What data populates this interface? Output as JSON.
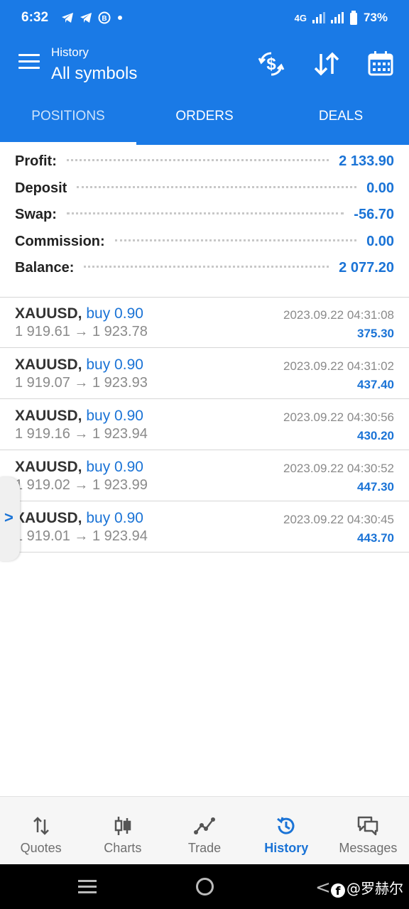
{
  "status_bar": {
    "time": "6:32",
    "network": "4G",
    "battery": "73%",
    "notif_icons": [
      "telegram-icon",
      "telegram-icon",
      "bitcoin-icon",
      "dot-icon"
    ]
  },
  "toolbar": {
    "subtitle": "History",
    "title": "All symbols",
    "icons": [
      "currency-exchange-icon",
      "sort-icon",
      "calendar-icon"
    ]
  },
  "tabs": [
    {
      "label": "POSITIONS",
      "active": true
    },
    {
      "label": "ORDERS",
      "active": false
    },
    {
      "label": "DEALS",
      "active": false
    }
  ],
  "summary": {
    "profit": {
      "label": "Profit:",
      "value": "2 133.90"
    },
    "deposit": {
      "label": "Deposit",
      "value": "0.00"
    },
    "swap": {
      "label": "Swap:",
      "value": "-56.70"
    },
    "commission": {
      "label": "Commission:",
      "value": "0.00"
    },
    "balance": {
      "label": "Balance:",
      "value": "2 077.20"
    }
  },
  "deals": [
    {
      "symbol": "XAUUSD,",
      "side": "buy 0.90",
      "open": "1 919.61",
      "arrow": "→",
      "close": "1 923.78",
      "time": "2023.09.22 04:31:08",
      "profit": "375.30"
    },
    {
      "symbol": "XAUUSD,",
      "side": "buy 0.90",
      "open": "1 919.07",
      "arrow": "→",
      "close": "1 923.93",
      "time": "2023.09.22 04:31:02",
      "profit": "437.40"
    },
    {
      "symbol": "XAUUSD,",
      "side": "buy 0.90",
      "open": "1 919.16",
      "arrow": "→",
      "close": "1 923.94",
      "time": "2023.09.22 04:30:56",
      "profit": "430.20"
    },
    {
      "symbol": "XAUUSD,",
      "side": "buy 0.90",
      "open": "1 919.02",
      "arrow": "→",
      "close": "1 923.99",
      "time": "2023.09.22 04:30:52",
      "profit": "447.30"
    },
    {
      "symbol": "XAUUSD,",
      "side": "buy 0.90",
      "open": "1 919.01",
      "arrow": "→",
      "close": "1 923.94",
      "time": "2023.09.22 04:30:45",
      "profit": "443.70"
    }
  ],
  "side_handle": ">",
  "bottom_nav": [
    {
      "label": "Quotes",
      "icon": "quotes-icon",
      "active": false
    },
    {
      "label": "Charts",
      "icon": "charts-icon",
      "active": false
    },
    {
      "label": "Trade",
      "icon": "trade-icon",
      "active": false
    },
    {
      "label": "History",
      "icon": "history-icon",
      "active": true
    },
    {
      "label": "Messages",
      "icon": "messages-icon",
      "active": false
    }
  ],
  "watermark": "@罗赫尔",
  "colors": {
    "primary": "#1a7ae6",
    "value_blue": "#1a73d6",
    "muted": "#8a8a8a"
  }
}
